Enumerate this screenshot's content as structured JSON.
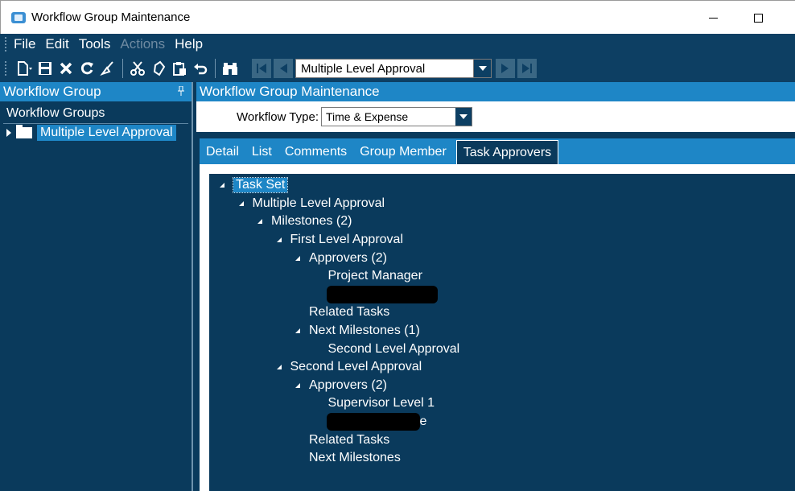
{
  "window": {
    "title": "Workflow Group Maintenance"
  },
  "menu": [
    "File",
    "Edit",
    "Tools",
    "Actions",
    "Help"
  ],
  "menu_disabled": [
    "Actions"
  ],
  "toolbar": {
    "icons": [
      "new-document-icon",
      "save-icon",
      "delete-icon",
      "refresh-icon",
      "clear-icon",
      "cut-icon",
      "copy-icon",
      "paste-icon",
      "undo-icon",
      "find-icon"
    ],
    "record_selector": "Multiple Level Approval"
  },
  "left_panel": {
    "header": "Workflow Group",
    "groups_label": "Workflow Groups",
    "item": "Multiple Level Approval"
  },
  "right_panel": {
    "header": "Workflow Group Maintenance",
    "workflow_type_label": "Workflow Type:",
    "workflow_type_value": "Time & Expense"
  },
  "tabs": [
    "Detail",
    "List",
    "Comments",
    "Group Member",
    "Task Approvers"
  ],
  "active_tab": "Task Approvers",
  "tree": [
    {
      "label": "Task Set",
      "level": 0,
      "expanded": true,
      "selected": true
    },
    {
      "label": "Multiple Level Approval",
      "level": 1,
      "expanded": true
    },
    {
      "label": "Milestones (2)",
      "level": 2,
      "expanded": true
    },
    {
      "label": "First Level Approval",
      "level": 3,
      "expanded": true
    },
    {
      "label": "Approvers (2)",
      "level": 4,
      "expanded": true
    },
    {
      "label": "Project Manager",
      "level": 5
    },
    {
      "label": "",
      "level": 5,
      "redacted": true,
      "redact_width": 138
    },
    {
      "label": "Related Tasks",
      "level": 4
    },
    {
      "label": "Next Milestones (1)",
      "level": 4,
      "expanded": true
    },
    {
      "label": "Second Level Approval",
      "level": 5
    },
    {
      "label": "Second Level Approval",
      "level": 3,
      "expanded": true
    },
    {
      "label": "Approvers (2)",
      "level": 4,
      "expanded": true
    },
    {
      "label": "Supervisor Level 1",
      "level": 5
    },
    {
      "label": "e",
      "level": 5,
      "redacted": true,
      "redact_width": 116
    },
    {
      "label": "Related Tasks",
      "level": 4
    },
    {
      "label": "Next Milestones",
      "level": 4
    }
  ],
  "colors": {
    "background": "#0a3a5c",
    "accent": "#1e86c6",
    "disabled": "#6e8aa1"
  }
}
